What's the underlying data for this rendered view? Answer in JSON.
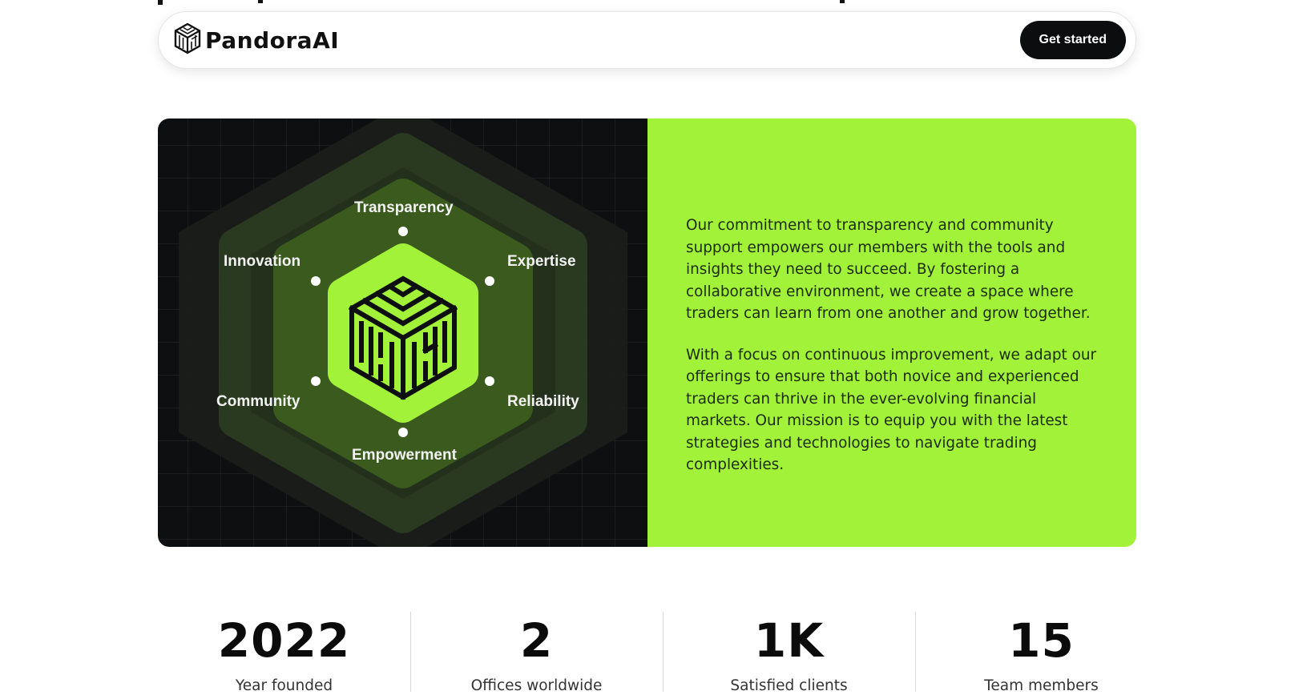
{
  "nav": {
    "brand": "PandoraAI",
    "cta_label": "Get started"
  },
  "values": {
    "transparency": "Transparency",
    "innovation": "Innovation",
    "expertise": "Expertise",
    "community": "Community",
    "reliability": "Reliability",
    "empowerment": "Empowerment"
  },
  "about": {
    "paragraph_1": "Our commitment to transparency and community support empowers our members with the tools and insights they need to succeed. By fostering a collaborative environment, we create a space where traders can learn from one another and grow together.",
    "paragraph_2": "With a focus on continuous improvement, we adapt our offerings to ensure that both novice and experienced traders can thrive in the ever-evolving financial markets. Our mission is to equip you with the latest strategies and technologies to navigate trading complexities."
  },
  "stats": [
    {
      "value": "2022",
      "label": "Year founded"
    },
    {
      "value": "2",
      "label": "Offices worldwide"
    },
    {
      "value": "1K",
      "label": "Satisfied clients"
    },
    {
      "value": "15",
      "label": "Team members"
    }
  ],
  "colors": {
    "accent": "#a3f23a",
    "dark": "#0e0f10",
    "text": "#111111"
  },
  "icons": {
    "brand_logo": "maze-cube-icon",
    "center_emblem": "maze-cube-icon"
  }
}
